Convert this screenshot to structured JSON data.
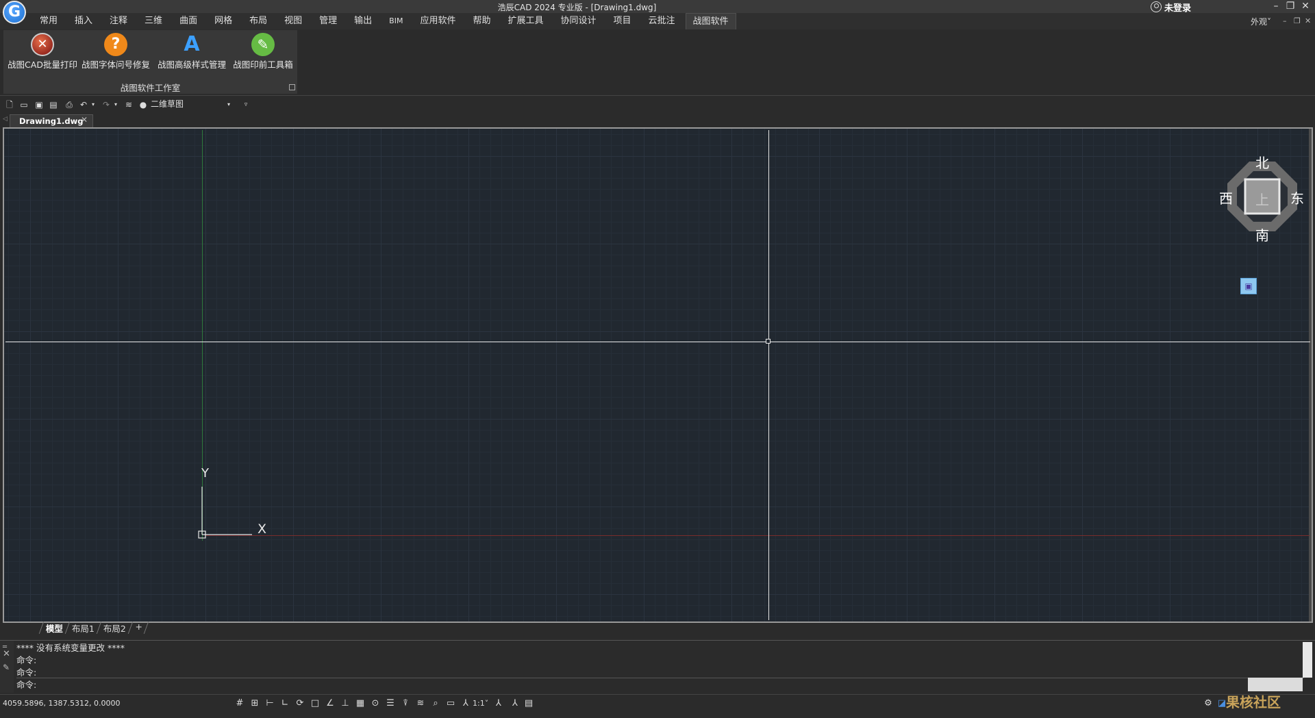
{
  "app": {
    "title": "浩辰CAD 2024 专业版 - [Drawing1.dwg]",
    "user": "未登录",
    "appearance": "外观"
  },
  "menu": {
    "tabs": [
      "常用",
      "插入",
      "注释",
      "三维",
      "曲面",
      "网格",
      "布局",
      "视图",
      "管理",
      "输出",
      "BIM",
      "应用软件",
      "帮助",
      "扩展工具",
      "协同设计",
      "项目",
      "云批注",
      "战图软件"
    ],
    "active": "战图软件"
  },
  "ribbon": {
    "buttons": [
      {
        "label": "战图CAD批量打印",
        "icon": "batch-print-icon"
      },
      {
        "label": "战图字体问号修复",
        "icon": "question-icon"
      },
      {
        "label": "战图高级样式管理",
        "icon": "text-style-icon"
      },
      {
        "label": "战图印前工具箱",
        "icon": "wrench-icon"
      }
    ],
    "panel_title": "战图软件工作室"
  },
  "quickbar": {
    "workspace": "二维草图"
  },
  "document": {
    "tab": "Drawing1.dwg"
  },
  "viewcube": {
    "top": "上",
    "north": "北",
    "south": "南",
    "east": "东",
    "west": "西"
  },
  "ucs": {
    "x": "X",
    "y": "Y"
  },
  "layout_tabs": [
    "模型",
    "布局1",
    "布局2",
    "+"
  ],
  "command": {
    "history": [
      "**** 没有系统变量更改 ****",
      "命令:",
      "命令:"
    ],
    "prompt": "命令:"
  },
  "status": {
    "coords": "4059.5896, 1387.5312, 0.0000",
    "scale": "1:1"
  },
  "watermark": "果核社区"
}
